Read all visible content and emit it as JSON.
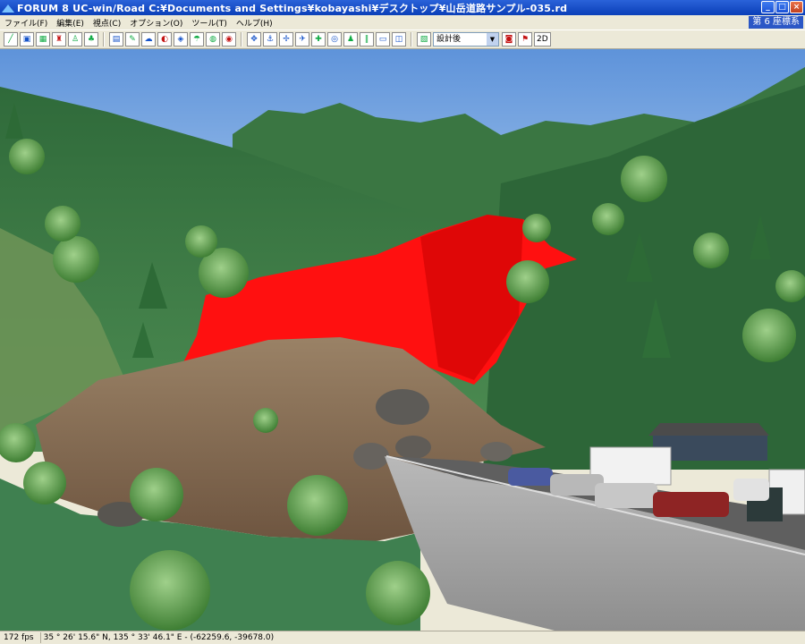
{
  "window": {
    "title": "FORUM 8    UC-win/Road    C:¥Documents and Settings¥kobayashi¥デスクトップ¥山岳道路サンプル-035.rd",
    "buttons": {
      "minimize": "_",
      "maximize": "□",
      "close": "×"
    }
  },
  "menu": {
    "items": [
      "ファイル(F)",
      "編集(E)",
      "視点(C)",
      "オプション(O)",
      "ツール(T)",
      "ヘルプ(H)"
    ],
    "coord_system": "第 6 座標系"
  },
  "toolbar": {
    "group1": [
      "road-icon",
      "camera-icon",
      "terrain-icon",
      "person-icon",
      "walk-icon",
      "tree-icon"
    ],
    "group2": [
      "open-icon",
      "edit-icon",
      "cloud-icon",
      "paint-icon",
      "car-icon",
      "rain-icon",
      "globe-icon",
      "target-icon"
    ],
    "group3": [
      "move-icon",
      "anchor-icon",
      "arrows-icon",
      "plane-icon",
      "plus-icon",
      "globe2-icon",
      "driver-icon",
      "pause-icon",
      "bus-icon",
      "map-icon"
    ],
    "scene_select": "設計後",
    "group4": [
      "photo-icon",
      "flag-icon"
    ],
    "mode_2d_label": "2D"
  },
  "scene": {
    "sky_color": "#6fa0dc",
    "terrain_color": "#3f7c45",
    "landslide_highlight_color": "#ff0000",
    "soil_color": "#8a6f55"
  },
  "status": {
    "fps": "172 fps",
    "coordinates": "35 ° 26' 15.6\" N, 135 ° 33' 46.1\" E  -  (-62259.6, -39678.0)"
  }
}
